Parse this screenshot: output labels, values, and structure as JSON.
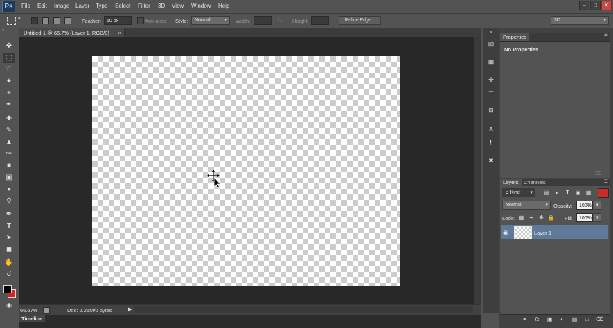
{
  "app": {
    "logo": "Ps"
  },
  "menu": [
    "File",
    "Edit",
    "Image",
    "Layer",
    "Type",
    "Select",
    "Filter",
    "3D",
    "View",
    "Window",
    "Help"
  ],
  "window_controls": {
    "minimize": "–",
    "maximize": "□",
    "close": "✕"
  },
  "options": {
    "feather_label": "Feather:",
    "feather_value": "10 px",
    "antialias_label": "Anti-alias",
    "style_label": "Style:",
    "style_value": "Normal",
    "width_label": "Width:",
    "height_label": "Height:",
    "refine_edge": "Refine Edge...",
    "workspace": "3D"
  },
  "document": {
    "tab_title": "Untitled-1 @ 66.7% (Layer 1, RGB/8)",
    "tab_close": "×",
    "zoom": "66.67%",
    "doc_info": "Doc: 2.25M/0 bytes"
  },
  "timeline": {
    "label": "Timeline"
  },
  "properties": {
    "tab": "Properties",
    "message": "No Properties"
  },
  "layers": {
    "tabs": [
      "Layers",
      "Channels"
    ],
    "filter_kind": "Kind",
    "blend_mode": "Normal",
    "opacity_label": "Opacity:",
    "opacity_value": "100%",
    "lock_label": "Lock:",
    "fill_label": "Fill:",
    "fill_value": "100%",
    "items": [
      {
        "name": "Layer 1",
        "visible": true
      }
    ]
  },
  "colors": {
    "foreground": "#000000",
    "background": "#e02020",
    "selection": "#5f7999"
  }
}
